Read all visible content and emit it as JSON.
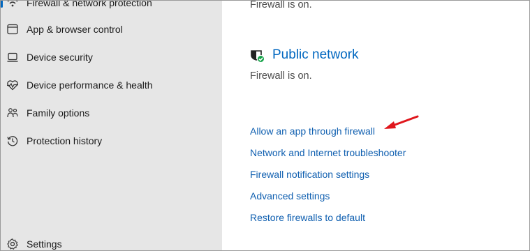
{
  "sidebar": {
    "items": [
      {
        "label": "Firewall & network protection",
        "icon": "wifi-icon"
      },
      {
        "label": "App & browser control",
        "icon": "browser-window-icon"
      },
      {
        "label": "Device security",
        "icon": "laptop-icon"
      },
      {
        "label": "Device performance & health",
        "icon": "heartbeat-icon"
      },
      {
        "label": "Family options",
        "icon": "family-icon"
      },
      {
        "label": "Protection history",
        "icon": "history-icon"
      }
    ],
    "settings_label": "Settings"
  },
  "main": {
    "top_status": "Firewall is on.",
    "public_network": {
      "title": "Public network",
      "status": "Firewall is on."
    },
    "links": [
      "Allow an app through firewall",
      "Network and Internet troubleshooter",
      "Firewall notification settings",
      "Advanced settings",
      "Restore firewalls to default"
    ]
  },
  "colors": {
    "accent": "#0067c0",
    "link": "#0f5fb0",
    "arrow": "#e0161c",
    "sidebar_bg": "#e6e6e6",
    "shield_check": "#16a34a"
  }
}
